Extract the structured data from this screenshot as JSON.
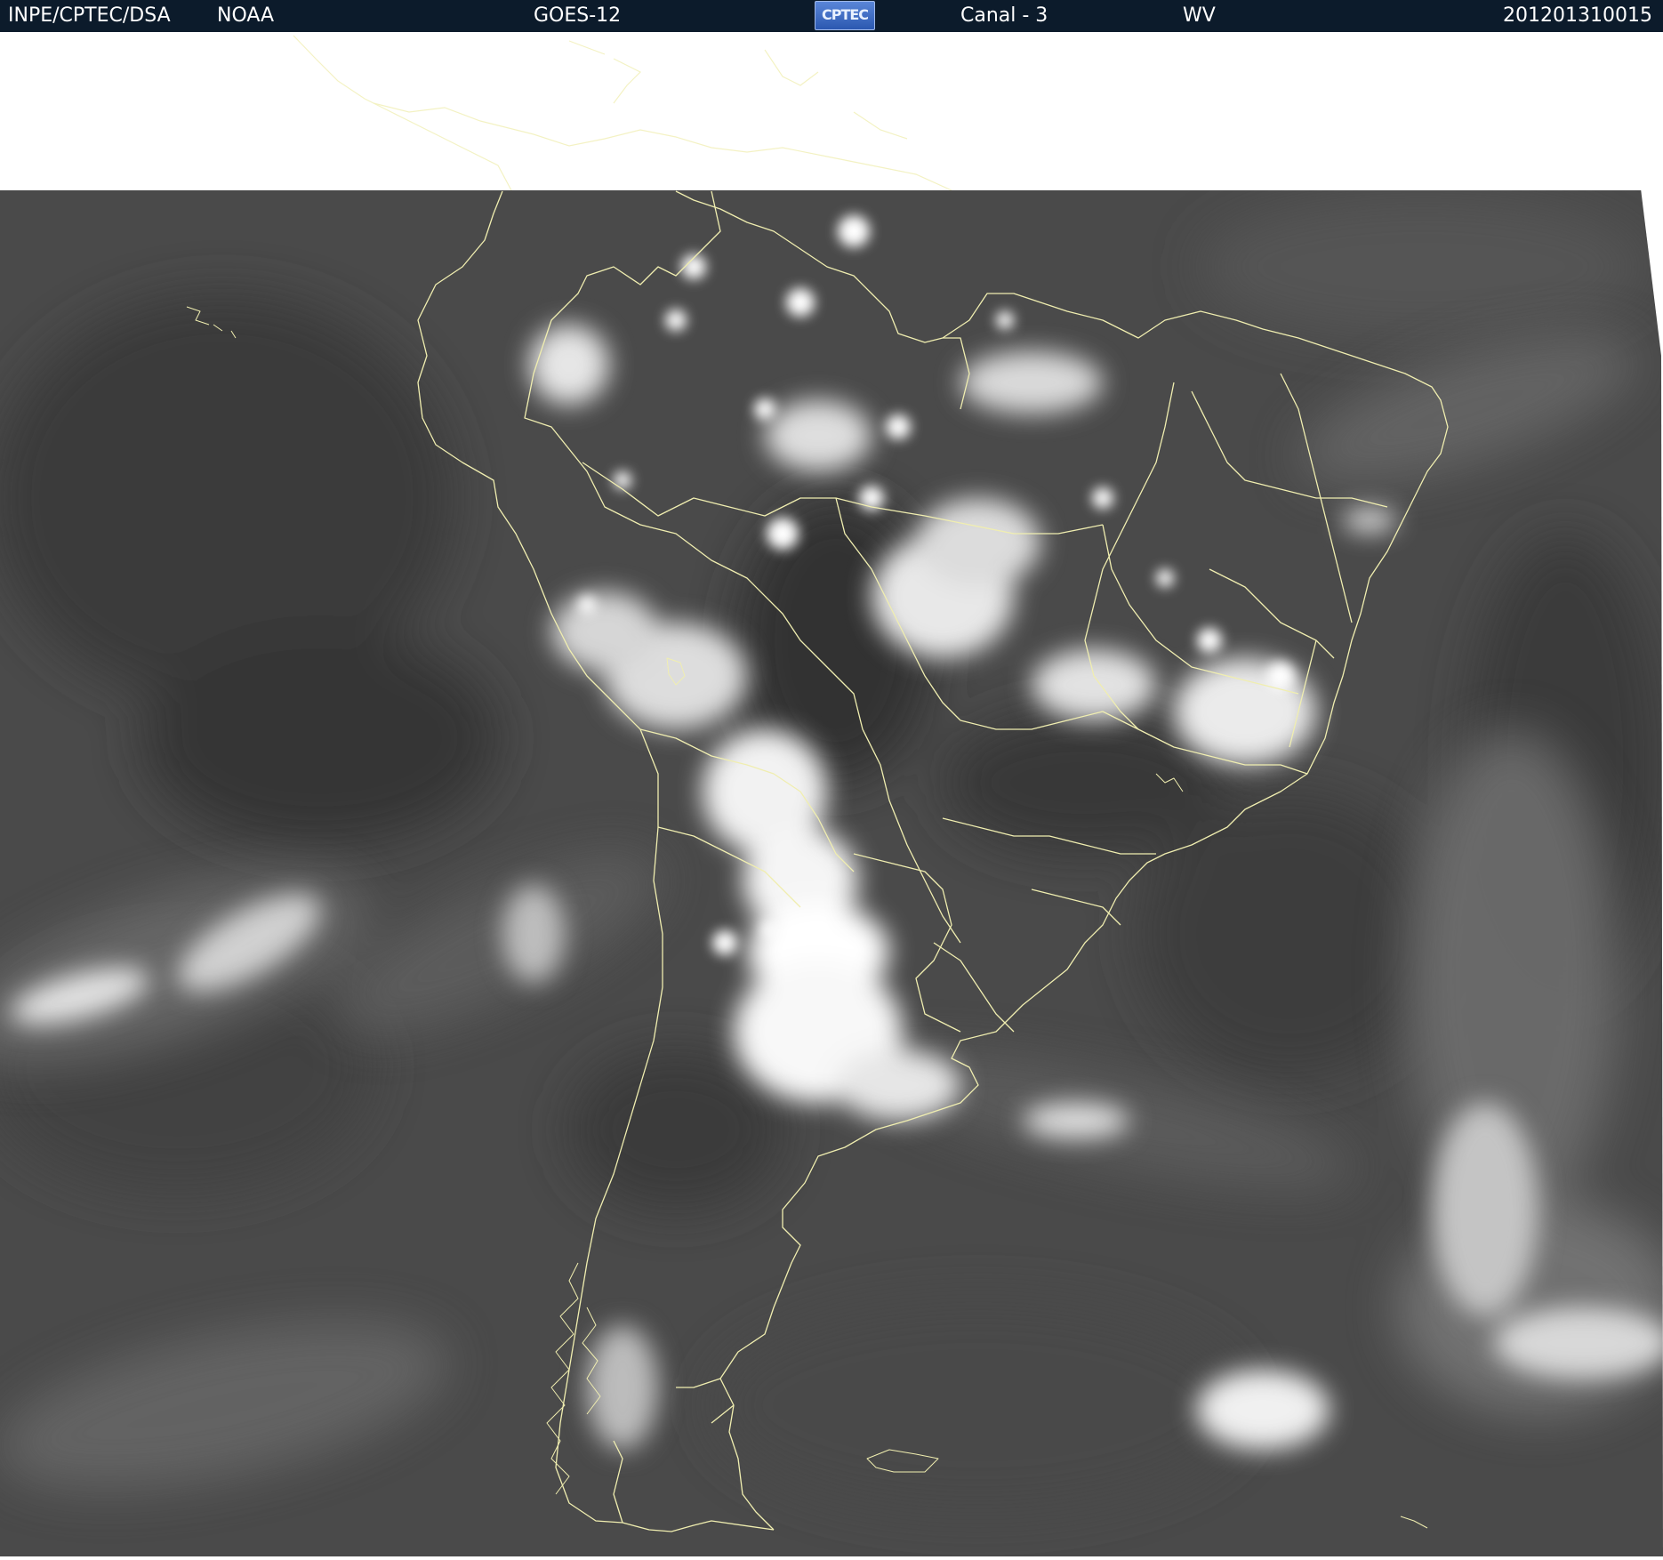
{
  "header": {
    "agency": "INPE/CPTEC/DSA",
    "source": "NOAA",
    "satellite": "GOES-12",
    "logo_text": "CPTEC",
    "channel": "Canal - 3",
    "band": "WV",
    "timestamp": "201201310015"
  },
  "colors": {
    "header_bg": "#0c1b2b",
    "header_text": "#ffffff",
    "coastline": "#f0eeb0",
    "ocean_gray": "#4e4e4e",
    "cloud_white": "#ffffff"
  },
  "image": {
    "description_icon": "satellite-water-vapor-imagery"
  }
}
